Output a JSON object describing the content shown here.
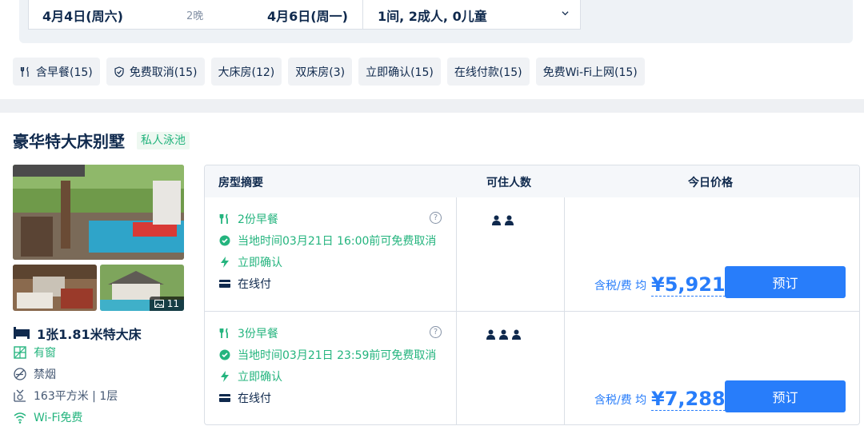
{
  "search": {
    "checkin": "4月4日(周六)",
    "nights": "2晚",
    "checkout": "4月6日(周一)",
    "rooms_guests": "1间, 2成人, 0儿童"
  },
  "filters": [
    {
      "label": "含早餐(15)",
      "icon": "fork-knife-icon"
    },
    {
      "label": "免费取消(15)",
      "icon": "shield-check-icon"
    },
    {
      "label": "大床房(12)"
    },
    {
      "label": "双床房(3)"
    },
    {
      "label": "立即确认(15)"
    },
    {
      "label": "在线付款(15)"
    },
    {
      "label": "免费Wi-Fi上网(15)"
    }
  ],
  "room": {
    "name": "豪华特大床别墅",
    "tag": "私人泳池",
    "photo_count": "11",
    "bed": "1张1.81米特大床",
    "attributes": [
      "有窗",
      "禁烟",
      "163平方米 | 1层",
      "Wi-Fi免费"
    ]
  },
  "table": {
    "headers": [
      "房型摘要",
      "可住人数",
      "今日价格"
    ],
    "rows": [
      {
        "breakfast": "2份早餐",
        "cancel": "当地时间03月21日 16:00前可免费取消",
        "confirm": "立即确认",
        "payment": "在线付",
        "guests": 2,
        "price_label": "含税/费 均",
        "price": "¥5,921",
        "book": "预订"
      },
      {
        "breakfast": "3份早餐",
        "cancel": "当地时间03月21日 23:59前可免费取消",
        "confirm": "立即确认",
        "payment": "在线付",
        "guests": 3,
        "price_label": "含税/费 均",
        "price": "¥7,288",
        "book": "预订"
      }
    ]
  },
  "colors": {
    "accent": "#287dfa",
    "green": "#24b47e",
    "text": "#0f294d"
  }
}
